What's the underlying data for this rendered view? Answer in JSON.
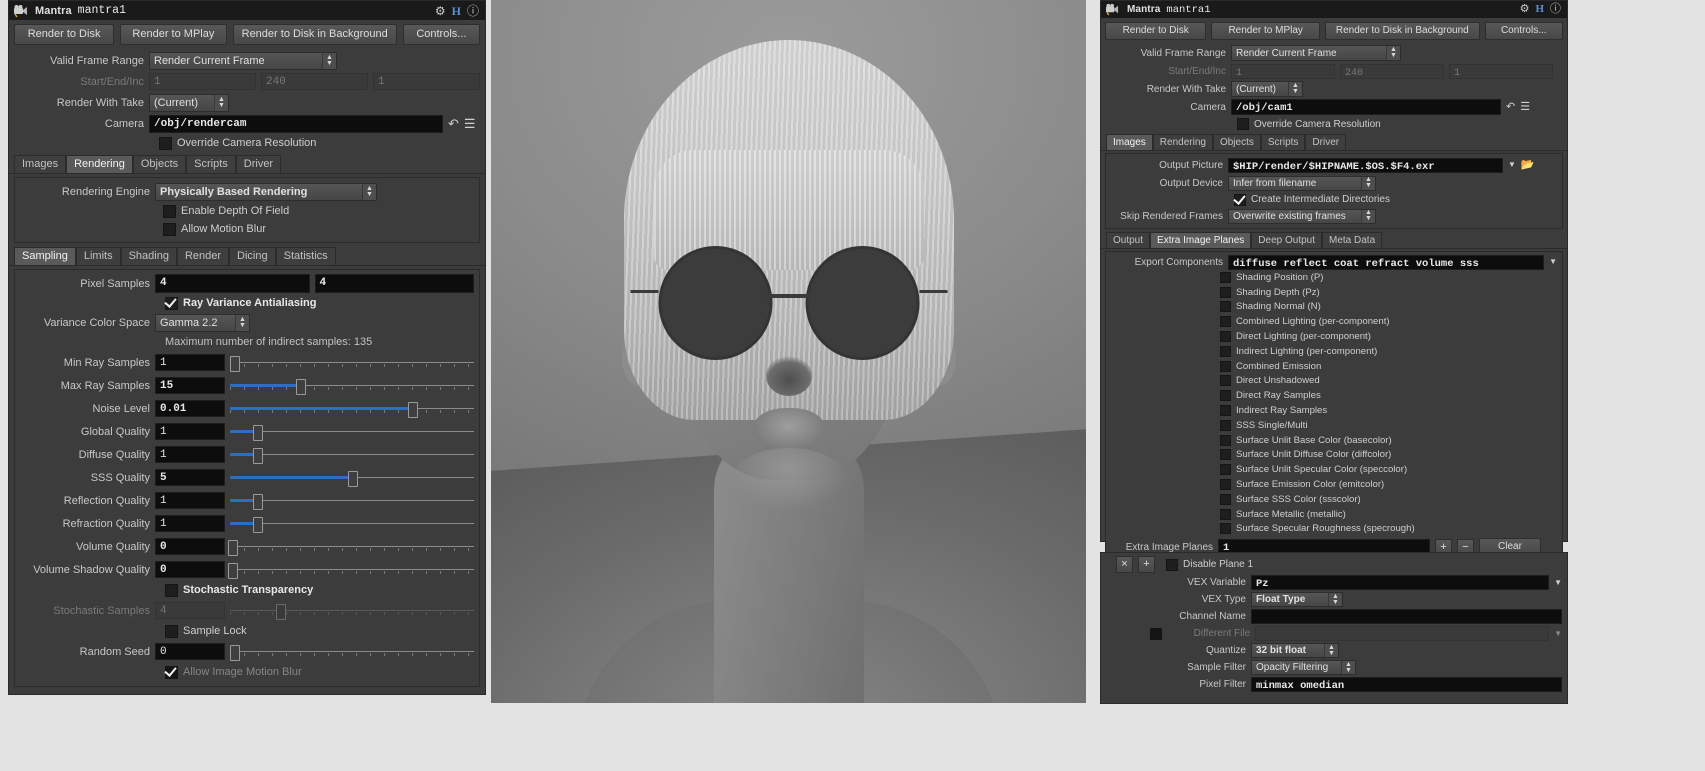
{
  "left_panel": {
    "title_label": "Mantra",
    "node_name": "mantra1",
    "icons": [
      "gear-icon",
      "houdini-icon",
      "info-icon"
    ],
    "buttons": [
      "Render to Disk",
      "Render to MPlay",
      "Render to Disk in Background",
      "Controls..."
    ],
    "valid_frame_range": {
      "label": "Valid Frame Range",
      "value": "Render Current Frame"
    },
    "start_end_inc": {
      "label": "Start/End/Inc",
      "start": "1",
      "end": "240",
      "inc": "1"
    },
    "render_with_take": {
      "label": "Render With Take",
      "value": "(Current)"
    },
    "camera": {
      "label": "Camera",
      "value": "/obj/rendercam"
    },
    "override_camera_resolution": {
      "label": "Override Camera Resolution",
      "checked": false
    },
    "main_tabs": [
      {
        "label": "Images",
        "active": false
      },
      {
        "label": "Rendering",
        "active": true
      },
      {
        "label": "Objects",
        "active": false
      },
      {
        "label": "Scripts",
        "active": false
      },
      {
        "label": "Driver",
        "active": false
      }
    ],
    "rendering_engine": {
      "label": "Rendering Engine",
      "value": "Physically Based Rendering"
    },
    "enable_depth_of_field": {
      "label": "Enable Depth Of Field",
      "checked": false
    },
    "allow_motion_blur": {
      "label": "Allow Motion Blur",
      "checked": false
    },
    "sub_tabs": [
      {
        "label": "Sampling",
        "active": true
      },
      {
        "label": "Limits",
        "active": false
      },
      {
        "label": "Shading",
        "active": false
      },
      {
        "label": "Render",
        "active": false
      },
      {
        "label": "Dicing",
        "active": false
      },
      {
        "label": "Statistics",
        "active": false
      }
    ],
    "pixel_samples": {
      "label": "Pixel Samples",
      "x": "4",
      "y": "4"
    },
    "ray_variance_antialiasing": {
      "label": "Ray Variance Antialiasing",
      "checked": true
    },
    "variance_color_space": {
      "label": "Variance Color Space",
      "value": "Gamma 2.2"
    },
    "indirect_note": "Maximum number of indirect samples: 135",
    "sliders": [
      {
        "label": "Min Ray Samples",
        "value": "1",
        "pct": 2,
        "fill": 0,
        "ticks": true,
        "disabled": false
      },
      {
        "label": "Max Ray Samples",
        "value": "15",
        "pct": 30,
        "fill": 30,
        "ticks": true,
        "disabled": false
      },
      {
        "label": "Noise Level",
        "value": "0.01",
        "pct": 75,
        "fill": 75,
        "ticks": true,
        "disabled": false
      },
      {
        "label": "Global Quality",
        "value": "1",
        "pct": 10,
        "fill": 10,
        "ticks": false,
        "disabled": false
      },
      {
        "label": "Diffuse Quality",
        "value": "1",
        "pct": 10,
        "fill": 10,
        "ticks": false,
        "disabled": false
      },
      {
        "label": "SSS Quality",
        "value": "5",
        "pct": 50,
        "fill": 50,
        "ticks": false,
        "disabled": false
      },
      {
        "label": "Reflection Quality",
        "value": "1",
        "pct": 10,
        "fill": 10,
        "ticks": false,
        "disabled": false
      },
      {
        "label": "Refraction Quality",
        "value": "1",
        "pct": 10,
        "fill": 10,
        "ticks": false,
        "disabled": false
      },
      {
        "label": "Volume Quality",
        "value": "0",
        "pct": 0,
        "fill": 0,
        "ticks": true,
        "disabled": false
      },
      {
        "label": "Volume Shadow Quality",
        "value": "0",
        "pct": 0,
        "fill": 0,
        "ticks": true,
        "disabled": false
      }
    ],
    "stochastic_transparency": {
      "label": "Stochastic Transparency",
      "checked": false
    },
    "stochastic_samples": {
      "label": "Stochastic Samples",
      "value": "4",
      "pct": 20,
      "disabled": true
    },
    "sample_lock": {
      "label": "Sample Lock",
      "checked": false
    },
    "random_seed": {
      "label": "Random Seed",
      "value": "0",
      "pct": 1
    },
    "allow_image_motion_blur": {
      "label": "Allow Image Motion Blur",
      "checked": true,
      "disabled": true
    }
  },
  "right_panel": {
    "title_label": "Mantra",
    "node_name": "mantra1",
    "buttons": [
      "Render to Disk",
      "Render to MPlay",
      "Render to Disk in Background",
      "Controls..."
    ],
    "valid_frame_range": {
      "label": "Valid Frame Range",
      "value": "Render Current Frame"
    },
    "start_end_inc": {
      "label": "Start/End/Inc",
      "start": "1",
      "end": "240",
      "inc": "1"
    },
    "render_with_take": {
      "label": "Render With Take",
      "value": "(Current)"
    },
    "camera": {
      "label": "Camera",
      "value": "/obj/cam1"
    },
    "override_camera_resolution": {
      "label": "Override Camera Resolution",
      "checked": false
    },
    "main_tabs": [
      {
        "label": "Images",
        "active": true
      },
      {
        "label": "Rendering",
        "active": false
      },
      {
        "label": "Objects",
        "active": false
      },
      {
        "label": "Scripts",
        "active": false
      },
      {
        "label": "Driver",
        "active": false
      }
    ],
    "output_picture": {
      "label": "Output Picture",
      "value": "$HIP/render/$HIPNAME.$OS.$F4.exr"
    },
    "output_device": {
      "label": "Output Device",
      "value": "Infer from filename"
    },
    "create_intermediate_directories": {
      "label": "Create Intermediate Directories",
      "checked": true
    },
    "skip_rendered_frames": {
      "label": "Skip Rendered Frames",
      "value": "Overwrite existing frames"
    },
    "sub_tabs": [
      {
        "label": "Output",
        "active": false
      },
      {
        "label": "Extra Image Planes",
        "active": true
      },
      {
        "label": "Deep Output",
        "active": false
      },
      {
        "label": "Meta Data",
        "active": false
      }
    ],
    "export_components": {
      "label": "Export Components",
      "value": "diffuse reflect coat refract volume sss"
    },
    "component_checkboxes": [
      {
        "label": "Shading Position (P)",
        "checked": false
      },
      {
        "label": "Shading Depth (Pz)",
        "checked": false
      },
      {
        "label": "Shading Normal (N)",
        "checked": false
      },
      {
        "label": "Combined Lighting (per-component)",
        "checked": false
      },
      {
        "label": "Direct Lighting (per-component)",
        "checked": false
      },
      {
        "label": "Indirect Lighting (per-component)",
        "checked": false
      },
      {
        "label": "Combined Emission",
        "checked": false
      },
      {
        "label": "Direct Unshadowed",
        "checked": false
      },
      {
        "label": "Direct Ray Samples",
        "checked": false
      },
      {
        "label": "Indirect Ray Samples",
        "checked": false
      },
      {
        "label": "SSS Single/Multi",
        "checked": false
      },
      {
        "label": "Surface Unlit Base Color (basecolor)",
        "checked": false
      },
      {
        "label": "Surface Unlit Diffuse Color (diffcolor)",
        "checked": false
      },
      {
        "label": "Surface Unlit Specular Color (speccolor)",
        "checked": false
      },
      {
        "label": "Surface Emission Color (emitcolor)",
        "checked": false
      },
      {
        "label": "Surface SSS Color (ssscolor)",
        "checked": false
      },
      {
        "label": "Surface Metallic (metallic)",
        "checked": false
      },
      {
        "label": "Surface Specular Roughness (specrough)",
        "checked": false
      }
    ],
    "extra_image_planes": {
      "label": "Extra Image Planes",
      "value": "1",
      "add": "+",
      "remove": "−",
      "clear": "Clear"
    }
  },
  "plane_panel": {
    "close_label": "×",
    "add_label": "+",
    "disable_plane": {
      "label": "Disable Plane 1",
      "checked": false
    },
    "vex_variable": {
      "label": "VEX Variable",
      "value": "Pz"
    },
    "vex_type": {
      "label": "VEX Type",
      "value": "Float Type"
    },
    "channel_name": {
      "label": "Channel Name",
      "value": ""
    },
    "different_file": {
      "label": "Different File",
      "checked": false,
      "value": ""
    },
    "quantize": {
      "label": "Quantize",
      "value": "32 bit float"
    },
    "sample_filter": {
      "label": "Sample Filter",
      "value": "Opacity Filtering"
    },
    "pixel_filter": {
      "label": "Pixel Filter",
      "value": "minmax omedian"
    }
  },
  "viewport": {
    "name": "render-preview"
  },
  "colors": {
    "panel_bg": "#3c3c3c",
    "field_bg": "#0d0d0d",
    "accent_blue": "#2b6fc4",
    "titlebar_bg": "#1a1a1a",
    "page_bg": "#e3e3e3"
  }
}
